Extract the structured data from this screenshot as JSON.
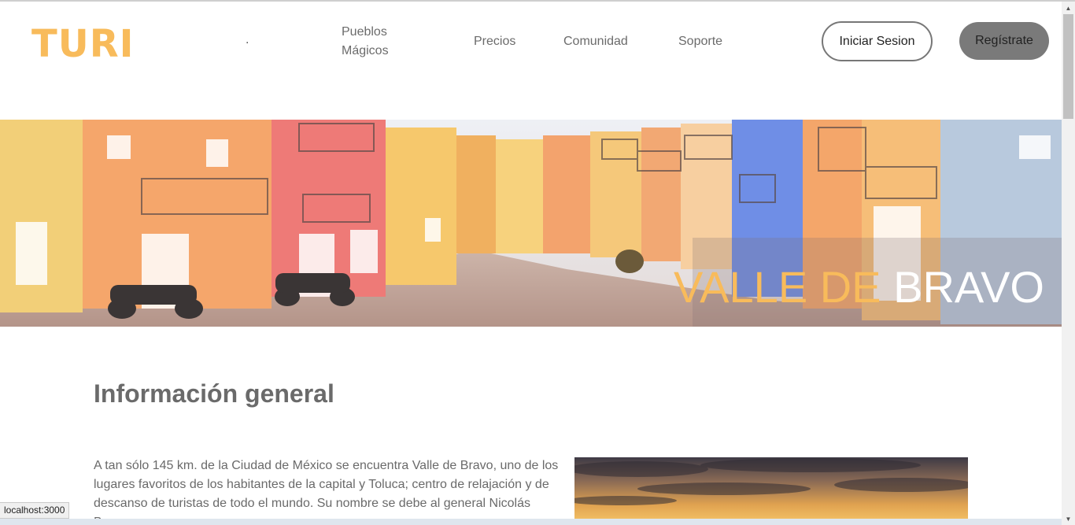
{
  "navbar": {
    "logo": "TURI",
    "dot": ".",
    "links": [
      {
        "label": "Pueblos Mágicos"
      },
      {
        "label": "Precios"
      },
      {
        "label": "Comunidad"
      },
      {
        "label": "Soporte"
      }
    ],
    "login_label": "Iniciar Sesion",
    "register_label": "Regístrate"
  },
  "hero": {
    "title_part1": "VALLE DE",
    "title_part2": "BRAVO"
  },
  "info": {
    "heading": "Información general",
    "paragraph": "A tan sólo 145 km. de la Ciudad de México se encuentra Valle de Bravo, uno de los lugares favoritos de los habitantes de la capital y Toluca; centro de relajación y de descanso de turistas de todo el mundo. Su nombre se debe al general Nicolás Bravo,"
  },
  "status_bar": {
    "url": "localhost:3000"
  },
  "colors": {
    "accent": "#f8bb5b",
    "text": "#6a6a6a",
    "register_bg": "#7a7a7a"
  },
  "icons": {
    "scroll_up": "triangle-up-icon",
    "scroll_down": "triangle-down-icon"
  }
}
